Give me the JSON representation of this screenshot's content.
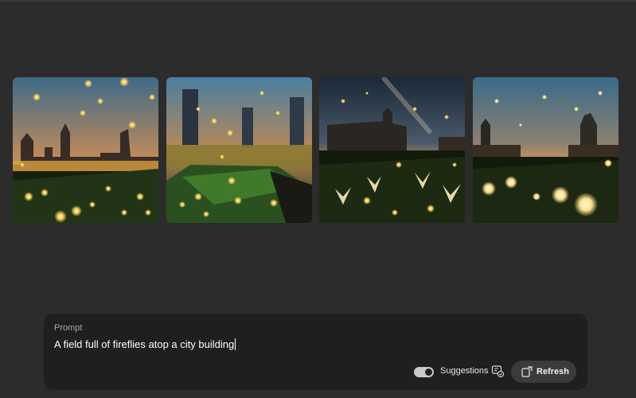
{
  "gallery": {
    "images": [
      {
        "alt": "fireflies-over-city-rooftop-1"
      },
      {
        "alt": "fireflies-over-city-rooftop-2"
      },
      {
        "alt": "fireflies-over-city-rooftop-3"
      },
      {
        "alt": "fireflies-over-city-rooftop-4"
      }
    ]
  },
  "prompt": {
    "label": "Prompt",
    "text": "A field full of fireflies atop a city building"
  },
  "controls": {
    "suggestions_label": "Suggestions",
    "suggestions_enabled": true,
    "refresh_label": "Refresh",
    "suggest_icon": "suggestion-check-icon",
    "refresh_icon": "refresh-icon"
  },
  "colors": {
    "background": "#2c2c2c",
    "panel": "#1f1f1f",
    "button": "#3b3b3b",
    "firefly_glow": "#ffd25a"
  }
}
